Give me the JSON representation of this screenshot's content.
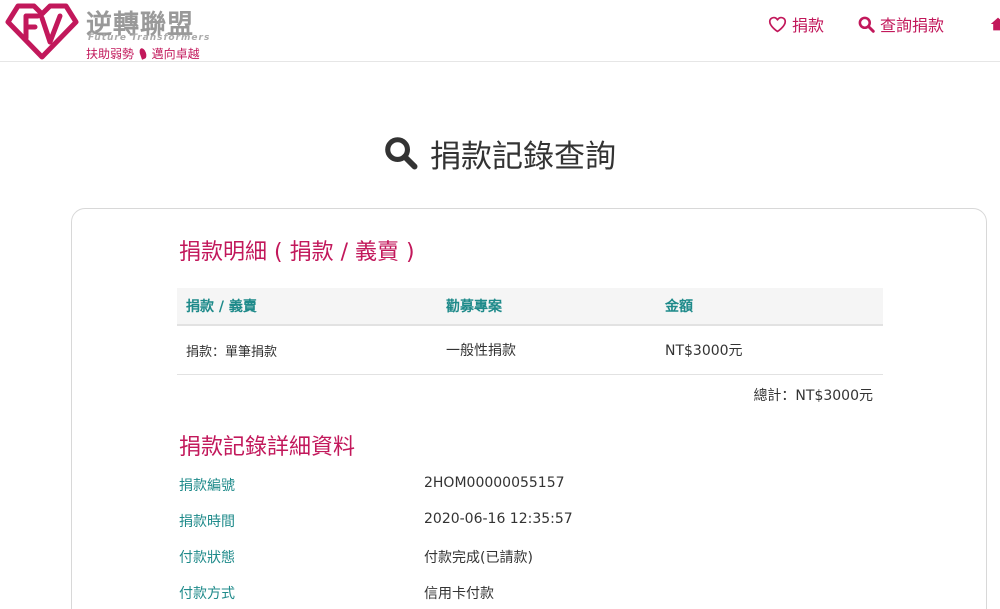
{
  "brand": {
    "name_cn": "逆轉聯盟",
    "name_en": "Future Transformers",
    "slogan_left": "扶助弱勢",
    "slogan_right": "邁向卓越",
    "color": "#c2185b"
  },
  "nav": {
    "donate": "捐款",
    "search_donation": "查詢捐款",
    "icons": [
      "heart-icon",
      "search-icon",
      "home-icon"
    ]
  },
  "page": {
    "title": "捐款記錄查詢"
  },
  "details_section": {
    "title": "捐款明細 ( 捐款 / 義賣 )",
    "columns": [
      "捐款 / 義賣",
      "勸募專案",
      "金額"
    ],
    "rows": [
      {
        "type": "捐款：單筆捐款",
        "project": "一般性捐款",
        "amount": "NT$3000元"
      }
    ],
    "total": "總計：NT$3000元"
  },
  "record_section": {
    "title": "捐款記錄詳細資料",
    "fields": [
      {
        "label": "捐款編號",
        "value": "2HOM00000055157"
      },
      {
        "label": "捐款時間",
        "value": "2020-06-16 12:35:57"
      },
      {
        "label": "付款狀態",
        "value": "付款完成(已請款)"
      },
      {
        "label": "付款方式",
        "value": "信用卡付款"
      }
    ]
  },
  "colors": {
    "accent": "#c2185b",
    "teal": "#1e8a8a"
  }
}
